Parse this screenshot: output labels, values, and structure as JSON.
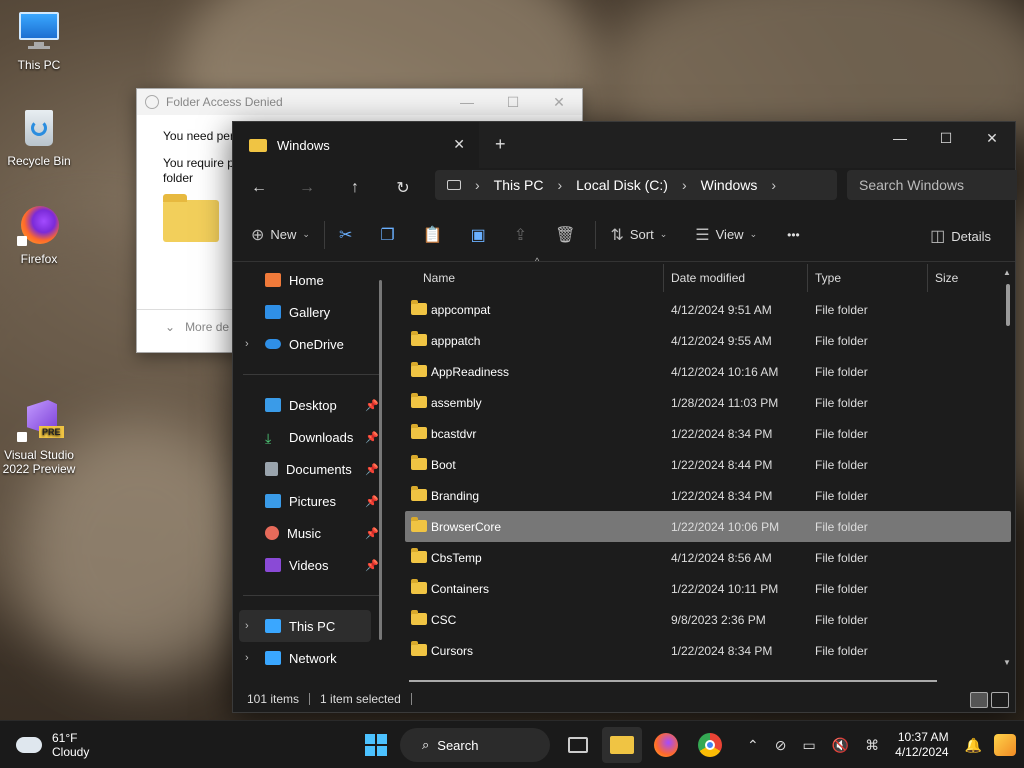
{
  "desktop": {
    "icons": [
      {
        "label": "This PC"
      },
      {
        "label": "Recycle Bin"
      },
      {
        "label": "Firefox"
      },
      {
        "label": "Visual Studio 2022 Preview",
        "badge": "PRE"
      }
    ]
  },
  "dialog": {
    "title": "Folder Access Denied",
    "line1": "You need per",
    "line2": "You require p",
    "line3": "folder",
    "more": "More de"
  },
  "explorer": {
    "tab_title": "Windows",
    "new_tab": "+",
    "breadcrumb": [
      "This PC",
      "Local Disk (C:)",
      "Windows"
    ],
    "search_placeholder": "Search Windows",
    "commands": {
      "new": "New",
      "sort": "Sort",
      "view": "View",
      "more": "•••",
      "details": "Details"
    },
    "nav": {
      "home": "Home",
      "gallery": "Gallery",
      "onedrive": "OneDrive",
      "desktop": "Desktop",
      "downloads": "Downloads",
      "documents": "Documents",
      "pictures": "Pictures",
      "music": "Music",
      "videos": "Videos",
      "thispc": "This PC",
      "network": "Network"
    },
    "columns": {
      "name": "Name",
      "date": "Date modified",
      "type": "Type",
      "size": "Size"
    },
    "rows": [
      {
        "name": "appcompat",
        "date": "4/12/2024 9:51 AM",
        "type": "File folder"
      },
      {
        "name": "apppatch",
        "date": "4/12/2024 9:55 AM",
        "type": "File folder"
      },
      {
        "name": "AppReadiness",
        "date": "4/12/2024 10:16 AM",
        "type": "File folder"
      },
      {
        "name": "assembly",
        "date": "1/28/2024 11:03 PM",
        "type": "File folder"
      },
      {
        "name": "bcastdvr",
        "date": "1/22/2024 8:34 PM",
        "type": "File folder"
      },
      {
        "name": "Boot",
        "date": "1/22/2024 8:44 PM",
        "type": "File folder"
      },
      {
        "name": "Branding",
        "date": "1/22/2024 8:34 PM",
        "type": "File folder"
      },
      {
        "name": "BrowserCore",
        "date": "1/22/2024 10:06 PM",
        "type": "File folder"
      },
      {
        "name": "CbsTemp",
        "date": "4/12/2024 8:56 AM",
        "type": "File folder"
      },
      {
        "name": "Containers",
        "date": "1/22/2024 10:11 PM",
        "type": "File folder"
      },
      {
        "name": "CSC",
        "date": "9/8/2023 2:36 PM",
        "type": "File folder"
      },
      {
        "name": "Cursors",
        "date": "1/22/2024 8:34 PM",
        "type": "File folder"
      }
    ],
    "status": {
      "items": "101 items",
      "selected": "1 item selected"
    }
  },
  "taskbar": {
    "temp": "61°F",
    "condition": "Cloudy",
    "search": "Search",
    "time": "10:37 AM",
    "date": "4/12/2024"
  },
  "colors": {
    "folder": "#f0c443",
    "accent": "#4cc2ff",
    "selected_row": "#777777"
  }
}
